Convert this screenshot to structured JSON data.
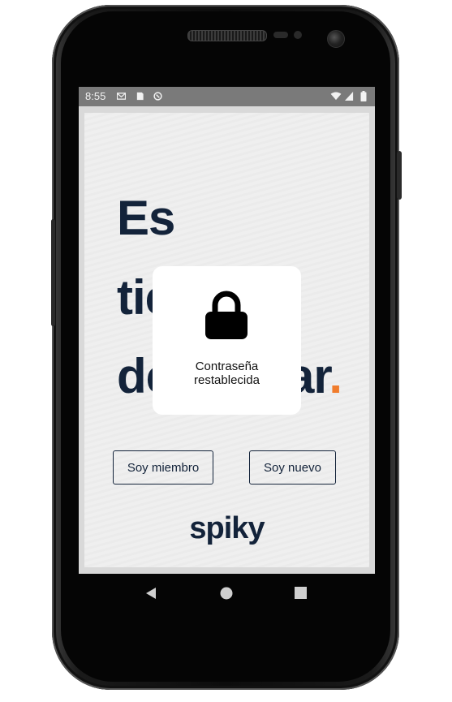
{
  "status_bar": {
    "time": "8:55",
    "left_icons": [
      "gmail-icon",
      "sd-card-icon",
      "sync-icon"
    ],
    "right_icons": [
      "wifi-icon",
      "signal-icon",
      "battery-icon"
    ]
  },
  "hero": {
    "line1": "Es",
    "line2": "tie",
    "line3_start": "de",
    "line3_end": "ar",
    "period": ".",
    "accent_color": "#f07c2c",
    "text_color": "#13233a"
  },
  "buttons": {
    "member_label": "Soy miembro",
    "new_label": "Soy nuevo"
  },
  "logo": {
    "text": "spiky"
  },
  "toast": {
    "icon": "lock-icon",
    "line1": "Contraseña",
    "line2": "restablecida"
  },
  "nav": {
    "back": "back-icon",
    "home": "home-icon",
    "recents": "recents-icon"
  }
}
